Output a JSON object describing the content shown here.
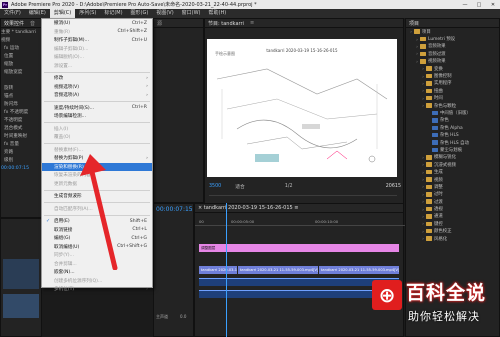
{
  "window": {
    "title": "Adobe Premiere Pro 2020 - D:\\Adobe\\Premiere Pro Auto-Save\\未命名-2020-03-21_22-40-44.prproj *",
    "app_icon": "Pr",
    "controls": [
      "—",
      "□",
      "✕"
    ]
  },
  "menubar": [
    "文件(F)",
    "编辑(E)",
    "剪辑(C)",
    "序列(S)",
    "标记(M)",
    "图形(G)",
    "视图(V)",
    "窗口(W)",
    "帮助(H)"
  ],
  "left_panel": {
    "tabs": [
      "效果控件",
      "音"
    ],
    "source_label": "主要 * tandkarri",
    "sequence_label": "视频",
    "fx_rows": [
      "fx 运动",
      "位置",
      "缩放",
      "缩放宽度",
      "",
      "旋转",
      "锚点",
      "防闪烁",
      "fx 不透明度",
      "不透明度",
      "混合模式",
      "时间重映射",
      "fx 音量",
      "旁路",
      "级别"
    ],
    "timecode": "00:00:07:15"
  },
  "program_monitor": {
    "tabs": [
      "节目: tandkarri",
      "≡"
    ],
    "frame_caption": "tandkarri 2020-03-19 15-16-26-015",
    "sketch_note": "手绘示意图",
    "timecode": "3500",
    "fit_label": "适合",
    "ratio_label": "1/2",
    "end_timecode": "20615"
  },
  "project_panel": {
    "title": "项目",
    "tree": [
      {
        "label": "项目",
        "level": 0
      },
      {
        "label": "Lumetri 预设",
        "level": 1
      },
      {
        "label": "音频效果",
        "level": 1
      },
      {
        "label": "音频过渡",
        "level": 1
      },
      {
        "label": "视频效果",
        "level": 1
      },
      {
        "label": "变换",
        "level": 2
      },
      {
        "label": "图像控制",
        "level": 2
      },
      {
        "label": "实用程序",
        "level": 2
      },
      {
        "label": "扭曲",
        "level": 2
      },
      {
        "label": "时间",
        "level": 2
      },
      {
        "label": "杂色与颗粒",
        "level": 2
      },
      {
        "label": "中间值（旧版）",
        "level": 3
      },
      {
        "label": "杂色",
        "level": 3
      },
      {
        "label": "杂色 Alpha",
        "level": 3
      },
      {
        "label": "杂色 HLS",
        "level": 3
      },
      {
        "label": "杂色 HLS 自动",
        "level": 3
      },
      {
        "label": "蒙尘与划痕",
        "level": 3
      },
      {
        "label": "模糊与锐化",
        "level": 2
      },
      {
        "label": "沉浸式视频",
        "level": 2
      },
      {
        "label": "生成",
        "level": 2
      },
      {
        "label": "视频",
        "level": 2
      },
      {
        "label": "调整",
        "level": 2
      },
      {
        "label": "过时",
        "level": 2
      },
      {
        "label": "过渡",
        "level": 2
      },
      {
        "label": "透视",
        "level": 2
      },
      {
        "label": "通道",
        "level": 2
      },
      {
        "label": "键控",
        "level": 2
      },
      {
        "label": "颜色校正",
        "level": 2
      },
      {
        "label": "风格化",
        "level": 2
      }
    ]
  },
  "timeline": {
    "tab": "× tandkarri 2020-03-19 15-16-26-015 ≡",
    "timecode": "00:00:07:15",
    "ruler": [
      "00",
      "00:00:05:00",
      "00:00:10:00"
    ],
    "tracks": {
      "v1_clip": "调整图层",
      "v2_clips": [
        "tandkarri 2020-03-19 15-16-26-015.mp4[V]",
        "tandkarri 2020-03-21 11-55-59-003.mp4[V]",
        "tandkarri 2020-03-21 11-55-59-003.mp4[V]"
      ],
      "audio_label": "主声道",
      "audio_value": "0.0"
    }
  },
  "edit_menu": {
    "items": [
      {
        "label": "撤消(U)",
        "shortcut": "Ctrl+Z",
        "state": "normal"
      },
      {
        "label": "重做(R)",
        "shortcut": "Ctrl+Shift+Z",
        "state": "disabled"
      },
      {
        "label": "制作子剪辑(M)...",
        "shortcut": "Ctrl+U",
        "state": "normal"
      },
      {
        "label": "编辑子剪辑(D)...",
        "state": "disabled"
      },
      {
        "label": "编辑脱机(O)...",
        "state": "disabled"
      },
      {
        "label": "源设置...",
        "state": "disabled"
      },
      {
        "sep": true
      },
      {
        "label": "修改",
        "submenu": true,
        "state": "normal"
      },
      {
        "label": "视频选项(V)",
        "submenu": true,
        "state": "normal"
      },
      {
        "label": "音频选项(A)",
        "submenu": true,
        "state": "normal"
      },
      {
        "sep": true
      },
      {
        "label": "速度/持续时间(S)...",
        "shortcut": "Ctrl+R",
        "state": "normal"
      },
      {
        "label": "场景编辑检测...",
        "state": "normal"
      },
      {
        "sep": true
      },
      {
        "label": "插入(I)",
        "state": "disabled"
      },
      {
        "label": "覆盖(O)",
        "state": "disabled"
      },
      {
        "sep": true
      },
      {
        "label": "替换素材(F)...",
        "state": "disabled"
      },
      {
        "label": "替换为剪辑(P)",
        "submenu": true,
        "state": "normal"
      },
      {
        "label": "渲染和替换(R)...",
        "state": "highlighted"
      },
      {
        "label": "恢复未渲染的内容",
        "state": "disabled"
      },
      {
        "label": "更新元数据",
        "state": "disabled"
      },
      {
        "sep": true
      },
      {
        "label": "生成音频波形",
        "state": "normal"
      },
      {
        "sep": true
      },
      {
        "label": "自动匹配序列(A)...",
        "state": "disabled"
      },
      {
        "sep": true
      },
      {
        "label": "启用(E)",
        "shortcut": "Shift+E",
        "state": "checked"
      },
      {
        "label": "取消链接",
        "shortcut": "Ctrl+L",
        "state": "normal"
      },
      {
        "label": "编组(G)",
        "shortcut": "Ctrl+G",
        "state": "normal"
      },
      {
        "label": "取消编组(U)",
        "shortcut": "Ctrl+Shift+G",
        "state": "normal"
      },
      {
        "label": "同步(Y)...",
        "state": "disabled"
      },
      {
        "label": "合并剪辑...",
        "state": "disabled"
      },
      {
        "label": "嵌套(N)...",
        "state": "normal"
      },
      {
        "label": "创建多机位源序列(Q)...",
        "state": "disabled"
      },
      {
        "label": "多机位(T)",
        "submenu": true,
        "state": "disabled"
      }
    ]
  },
  "watermark": {
    "logo_glyph": "⊕",
    "title": "百科全说",
    "subtitle": "助你轻松解决"
  },
  "colors": {
    "accent_blue": "#3aa0ff",
    "menu_highlight": "#2e78d6",
    "clip_pink": "#e686e6",
    "clip_blue": "#6f7fd9",
    "arrow_red": "#e5262a",
    "watermark_red": "#e01e1e"
  }
}
